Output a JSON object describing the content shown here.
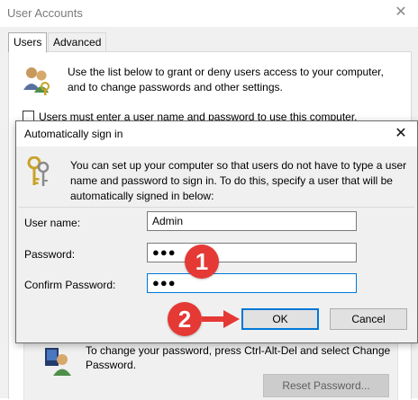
{
  "background_window": {
    "title": "User Accounts",
    "tabs": [
      {
        "label": "Users"
      },
      {
        "label": "Advanced"
      }
    ],
    "intro_text": "Use the list below to grant or deny users access to your computer, and to change passwords and other settings.",
    "checkbox_label": "Users must enter a user name and password to use this computer.",
    "password_text": "To change your password, press Ctrl-Alt-Del and select Change Password.",
    "reset_password_label": "Reset Password..."
  },
  "dialog": {
    "title": "Automatically sign in",
    "description": "You can set up your computer so that users do not have to type a user name and password to sign in. To do this, specify a user that will be automatically signed in below:",
    "fields": {
      "user_name": {
        "label": "User name:",
        "value": "Admin"
      },
      "password": {
        "label": "Password:",
        "value": "●●●"
      },
      "confirm_password": {
        "label": "Confirm Password:",
        "value": "●●●"
      }
    },
    "ok_label": "OK",
    "cancel_label": "Cancel"
  },
  "callouts": [
    {
      "number": "1",
      "color": "#e53935"
    },
    {
      "number": "2",
      "color": "#e53935"
    }
  ],
  "colors": {
    "accent": "#0078d7",
    "callout": "#e53935"
  }
}
